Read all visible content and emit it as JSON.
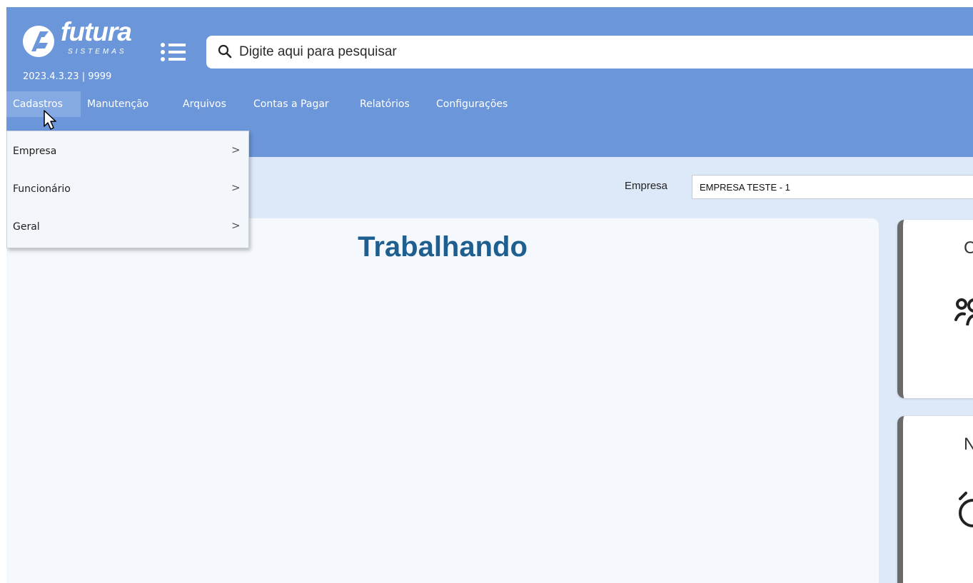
{
  "brand": {
    "name": "futura",
    "sub": "SISTEMAS"
  },
  "header": {
    "version": "2023.4.3.23 | 9999"
  },
  "search": {
    "placeholder": "Digite aqui para pesquisar"
  },
  "menu": [
    {
      "label": "Cadastros",
      "active": true
    },
    {
      "label": "Manutenção"
    },
    {
      "label": "Arquivos"
    },
    {
      "label": "Contas a Pagar"
    },
    {
      "label": "Relatórios"
    },
    {
      "label": "Configurações"
    }
  ],
  "dropdown": {
    "items": [
      {
        "label": "Empresa",
        "chevron": ">"
      },
      {
        "label": "Funcionário",
        "chevron": ">"
      },
      {
        "label": "Geral",
        "chevron": ">"
      }
    ]
  },
  "company": {
    "label": "Empresa",
    "value": "EMPRESA TESTE - 1"
  },
  "main": {
    "title": "Trabalhando"
  },
  "side_cards": [
    {
      "title_fragment": "C",
      "icon": "users-icon"
    },
    {
      "title_fragment": "N",
      "icon": "alarm-clock-icon"
    }
  ],
  "colors": {
    "topbar": "#6b96da",
    "background": "#dde8f8",
    "title": "#1f5f8f",
    "active_menu": "#85a9e2"
  }
}
